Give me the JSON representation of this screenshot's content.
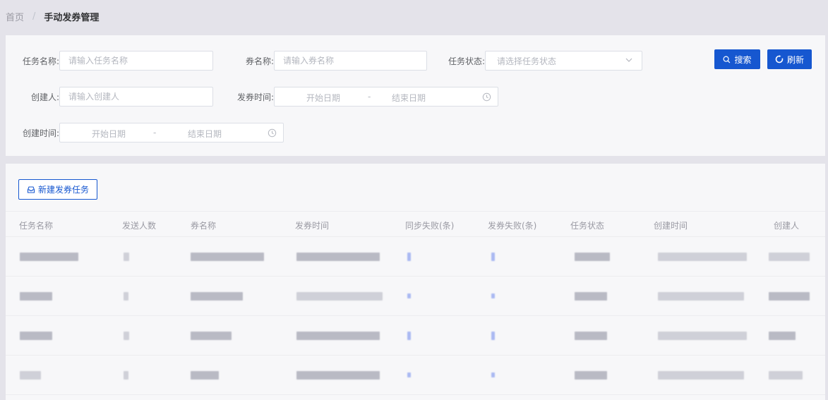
{
  "breadcrumb": {
    "home": "首页",
    "separator": "/",
    "current": "手动发券管理"
  },
  "filters": {
    "task_name": {
      "label": "任务名称:",
      "placeholder": "请输入任务名称"
    },
    "coupon_name": {
      "label": "券名称:",
      "placeholder": "请输入券名称"
    },
    "task_status": {
      "label": "任务状态:",
      "placeholder": "请选择任务状态"
    },
    "creator": {
      "label": "创建人:",
      "placeholder": "请输入创建人"
    },
    "issue_time": {
      "label": "发券时间:",
      "start": "开始日期",
      "separator": "-",
      "end": "结束日期"
    },
    "create_time": {
      "label": "创建时间:",
      "start": "开始日期",
      "separator": "-",
      "end": "结束日期"
    }
  },
  "actions": {
    "search": "搜索",
    "refresh": "刷新",
    "new_task": "新建发券任务"
  },
  "table": {
    "columns": [
      "任务名称",
      "发送人数",
      "券名称",
      "发券时间",
      "同步失败(条)",
      "发券失败(条)",
      "任务状态",
      "创建时间",
      "创建人"
    ]
  },
  "colors": {
    "primary": "#1657d0",
    "background": "#e4e3ea",
    "panel": "#f7f7f9"
  },
  "icons": [
    "search-icon",
    "refresh-icon",
    "chevron-down-icon",
    "clock-icon",
    "new-task-icon"
  ]
}
